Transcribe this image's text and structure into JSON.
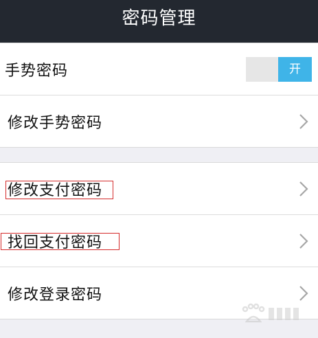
{
  "header": {
    "title": "密码管理"
  },
  "groups": [
    {
      "rows": [
        {
          "label": "手势密码",
          "toggle_text": "开",
          "toggle_on": true
        },
        {
          "label": "修改手势密码"
        }
      ]
    },
    {
      "rows": [
        {
          "label": "修改支付密码"
        },
        {
          "label": "找回支付密码"
        },
        {
          "label": "修改登录密码"
        }
      ]
    }
  ],
  "colors": {
    "header_bg": "#232830",
    "toggle_on": "#3fb4e8",
    "annotation_box": "#d42a2a"
  },
  "icons": {
    "row_arrow": "chevron-right-icon",
    "watermark": "baidu-jingyan-logo"
  }
}
